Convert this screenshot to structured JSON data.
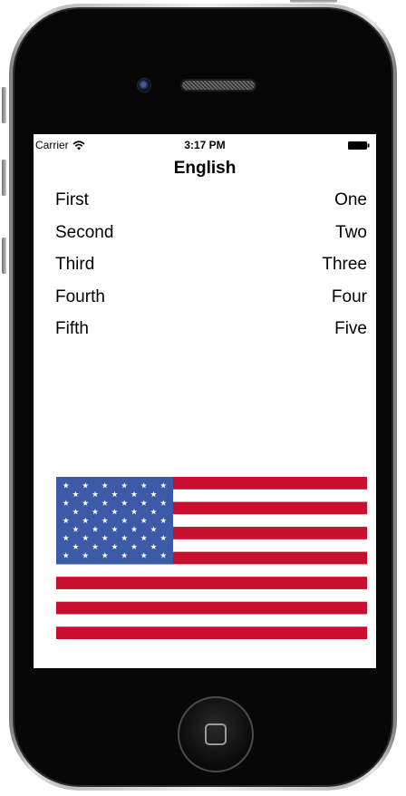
{
  "status_bar": {
    "carrier": "Carrier",
    "time": "3:17 PM",
    "wifi_icon": "wifi-icon",
    "battery_icon": "battery-icon"
  },
  "nav": {
    "title": "English"
  },
  "words": [
    {
      "ordinal": "First",
      "cardinal": "One"
    },
    {
      "ordinal": "Second",
      "cardinal": "Two"
    },
    {
      "ordinal": "Third",
      "cardinal": "Three"
    },
    {
      "ordinal": "Fourth",
      "cardinal": "Four"
    },
    {
      "ordinal": "Fifth",
      "cardinal": "Five"
    }
  ],
  "flag": {
    "icon": "us-flag-image",
    "stripe_red": "#c8102e",
    "stripe_white": "#ffffff",
    "canton_blue": "#3c5aa8",
    "star_white": "#ffffff"
  },
  "device": {
    "home_icon": "home-button-icon"
  }
}
